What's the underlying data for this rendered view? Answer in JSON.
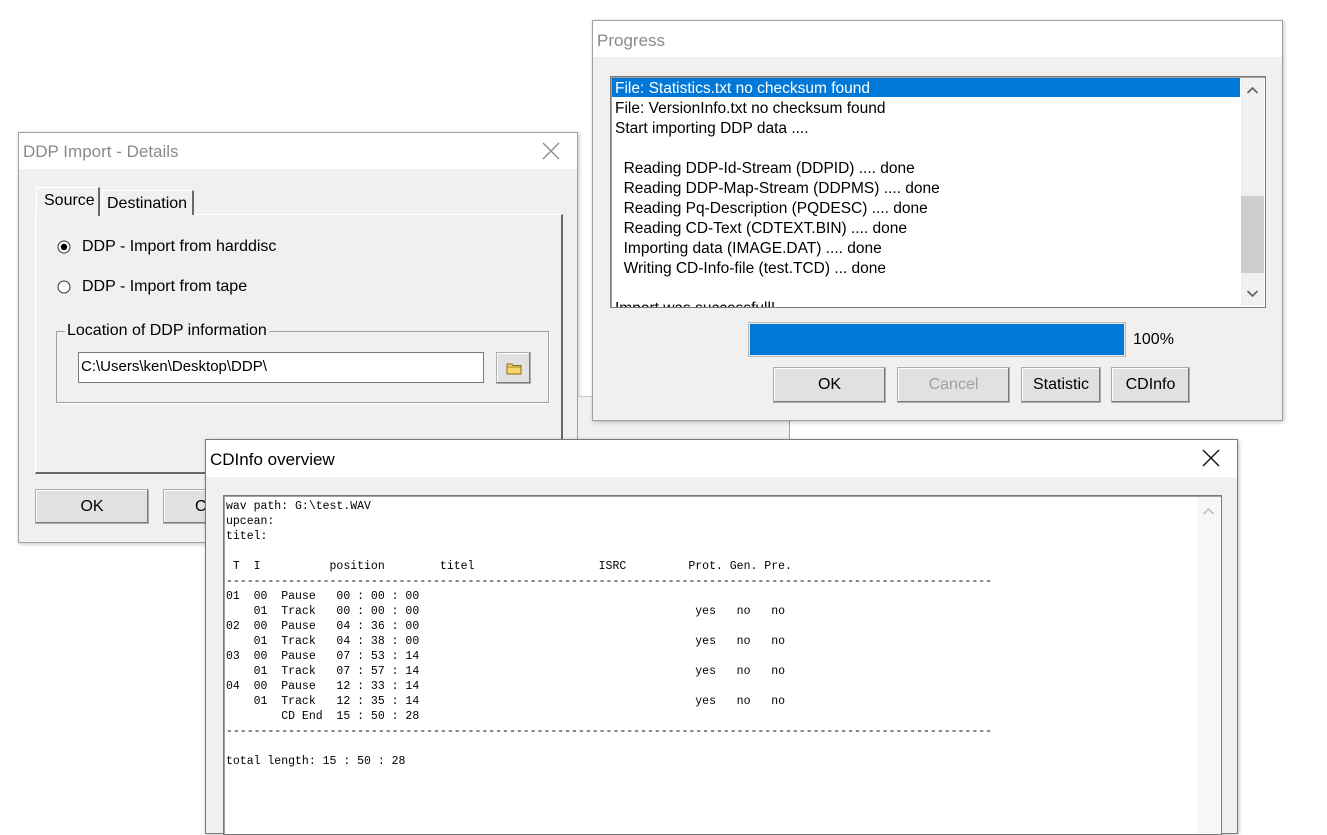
{
  "ddp_window": {
    "title": "DDP Import - Details",
    "tabs": [
      "Source",
      "Destination"
    ],
    "radio_harddisc": "DDP - Import from harddisc",
    "radio_tape": "DDP - Import from tape",
    "selected_radio": "harddisc",
    "group_label": "Location of DDP information",
    "path_value": "C:\\Users\\ken\\Desktop\\DDP\\",
    "ok_label": "OK",
    "cancel_label": "C"
  },
  "progress_window": {
    "title": "Progress",
    "log_lines": [
      "File: Statistics.txt no checksum found",
      "File: VersionInfo.txt no checksum found",
      "Start importing DDP data ....",
      "",
      "  Reading DDP-Id-Stream (DDPID) .... done",
      "  Reading DDP-Map-Stream (DDPMS) .... done",
      "  Reading Pq-Description (PQDESC) .... done",
      "  Reading CD-Text (CDTEXT.BIN) .... done",
      "  Importing data (IMAGE.DAT) .... done",
      "  Writing CD-Info-file (test.TCD) ... done",
      "",
      "Import was successfull!"
    ],
    "selected_line": 0,
    "progress_percent": 100,
    "progress_text": "100%",
    "buttons": {
      "ok": "OK",
      "cancel": "Cancel",
      "statistic": "Statistic",
      "cdinfo": "CDInfo"
    }
  },
  "cdinfo_window": {
    "title": "CDInfo overview",
    "text": "wav path: G:\\test.WAV\nupcean:\ntitel:\n\n T  I          position        titel                  ISRC         Prot. Gen. Pre.\n---------------------------------------------------------------------------------------------------------------\n01  00  Pause   00 : 00 : 00\n    01  Track   00 : 00 : 00                                        yes   no   no\n02  00  Pause   04 : 36 : 00\n    01  Track   04 : 38 : 00                                        yes   no   no\n03  00  Pause   07 : 53 : 14\n    01  Track   07 : 57 : 14                                        yes   no   no\n04  00  Pause   12 : 33 : 14\n    01  Track   12 : 35 : 14                                        yes   no   no\n        CD End  15 : 50 : 28\n---------------------------------------------------------------------------------------------------------------\n\ntotal length: 15 : 50 : 28"
  }
}
